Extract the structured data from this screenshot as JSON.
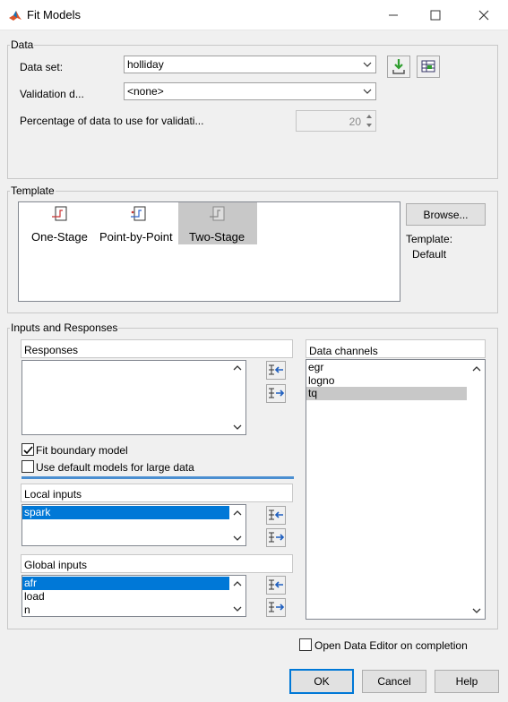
{
  "window": {
    "title": "Fit Models"
  },
  "data_group": {
    "label": "Data",
    "data_set_label": "Data set:",
    "data_set_value": "holliday",
    "validation_label": "Validation d...",
    "validation_value": "<none>",
    "percentage_label": "Percentage of data to use for validati...",
    "percentage_value": "20"
  },
  "template_group": {
    "label": "Template",
    "items": [
      "One-Stage",
      "Point-by-Point",
      "Two-Stage"
    ],
    "browse_label": "Browse...",
    "template_label": "Template:",
    "template_value": "Default"
  },
  "inputs_group": {
    "label": "Inputs and Responses",
    "responses_label": "Responses",
    "fit_boundary_label": "Fit boundary model",
    "fit_boundary_checked": true,
    "default_models_label": "Use default models for large data",
    "default_models_checked": false,
    "local_inputs_label": "Local inputs",
    "local_inputs": [
      "spark"
    ],
    "global_inputs_label": "Global inputs",
    "global_inputs": [
      "afr",
      "load",
      "n"
    ],
    "data_channels_label": "Data channels",
    "data_channels": [
      "egr",
      "logno",
      "tq"
    ]
  },
  "footer": {
    "open_editor_label": "Open Data Editor on completion",
    "ok_label": "OK",
    "cancel_label": "Cancel",
    "help_label": "Help"
  },
  "colors": {
    "selection": "#0078d7",
    "default_button_border": "#0078d7"
  }
}
